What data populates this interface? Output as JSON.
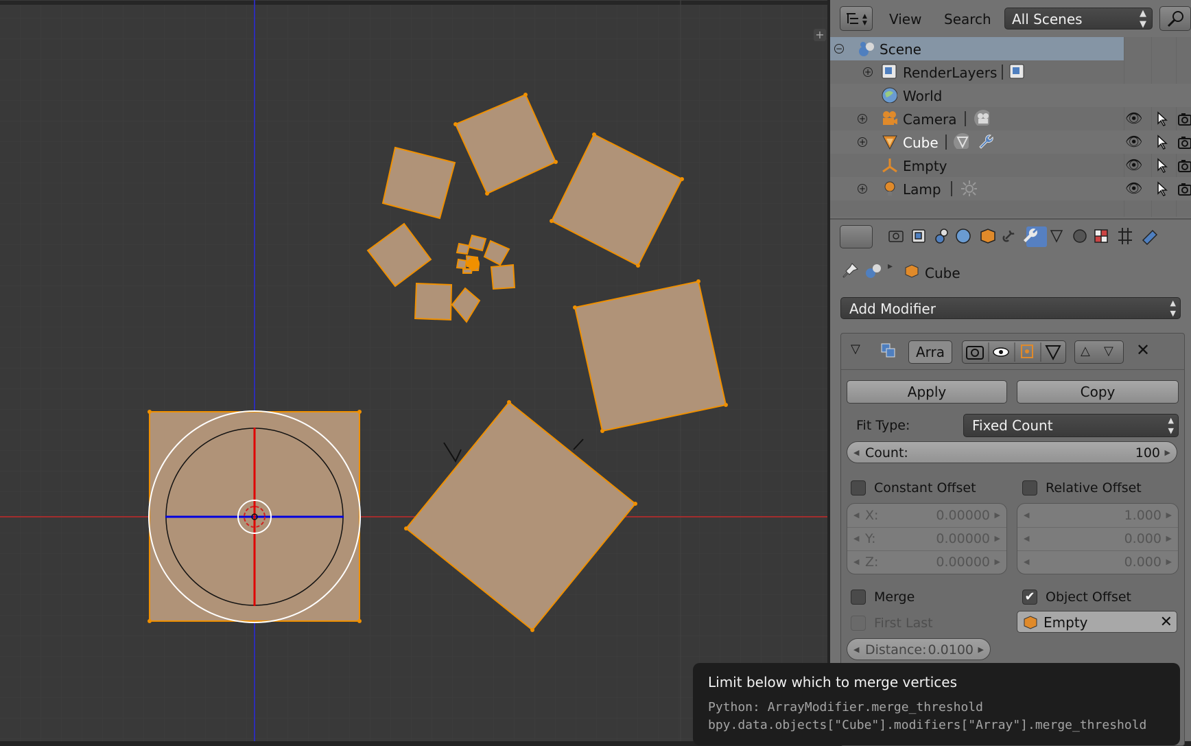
{
  "outliner": {
    "menu_view": "View",
    "menu_search": "Search",
    "scene_select": "All Scenes",
    "items": [
      {
        "label": "Scene"
      },
      {
        "label": "RenderLayers"
      },
      {
        "label": "World"
      },
      {
        "label": "Camera"
      },
      {
        "label": "Cube"
      },
      {
        "label": "Empty"
      },
      {
        "label": "Lamp"
      }
    ]
  },
  "properties": {
    "breadcrumb_object": "Cube",
    "add_modifier": "Add Modifier",
    "modifier": {
      "name": "Arra",
      "apply_label": "Apply",
      "copy_label": "Copy",
      "fit_type_label": "Fit Type:",
      "fit_type_value": "Fixed Count",
      "count_label": "Count:",
      "count_value": "100",
      "constant_offset_label": "Constant Offset",
      "relative_offset_label": "Relative Offset",
      "constant": {
        "x_label": "X:",
        "x": "0.00000",
        "y_label": "Y:",
        "y": "0.00000",
        "z_label": "Z:",
        "z": "0.00000"
      },
      "relative": {
        "x": "1.000",
        "y": "0.000",
        "z": "0.000"
      },
      "merge_label": "Merge",
      "object_offset_label": "Object Offset",
      "first_last_label": "First Last",
      "offset_object": "Empty",
      "distance_label": "Distance:",
      "distance_value": "0.0100",
      "constant_offset_checked": false,
      "relative_offset_checked": false,
      "merge_checked": false,
      "object_offset_checked": true,
      "first_last_checked": false
    }
  },
  "tooltip": {
    "title": "Limit below which to merge vertices",
    "python_line": "Python: ArrayModifier.merge_threshold",
    "path_line": "bpy.data.objects[\"Cube\"].modifiers[\"Array\"].merge_threshold"
  },
  "colors": {
    "viewport_bg": "#393939",
    "mesh_fill": "#b09378",
    "mesh_edge": "#f09000",
    "panel_bg": "#727272",
    "active_tab": "#5680c2",
    "tooltip_bg": "#1d1d1d"
  }
}
